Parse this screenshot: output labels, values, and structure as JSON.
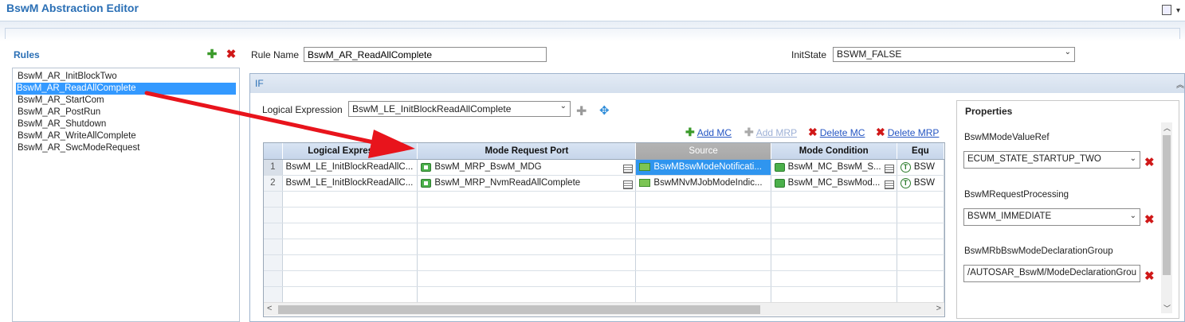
{
  "window": {
    "title": "BswM Abstraction Editor"
  },
  "rules": {
    "label": "Rules",
    "items": [
      {
        "label": "BswM_AR_InitBlockTwo",
        "selected": false
      },
      {
        "label": "BswM_AR_ReadAllComplete",
        "selected": true
      },
      {
        "label": "BswM_AR_StartCom",
        "selected": false
      },
      {
        "label": "BswM_AR_PostRun",
        "selected": false
      },
      {
        "label": "BswM_AR_Shutdown",
        "selected": false
      },
      {
        "label": "BswM_AR_WriteAllComplete",
        "selected": false
      },
      {
        "label": "BswM_AR_SwcModeRequest",
        "selected": false
      }
    ]
  },
  "rule_name": {
    "label": "Rule Name",
    "value": "BswM_AR_ReadAllComplete"
  },
  "init_state": {
    "label": "InitState",
    "value": "BSWM_FALSE"
  },
  "if_section": {
    "label": "IF",
    "logical_expression": {
      "label": "Logical Expression",
      "value": "BswM_LE_InitBlockReadAllComplete"
    },
    "actions": {
      "add_mc": "Add MC",
      "add_mrp": "Add MRP",
      "delete_mc": "Delete MC",
      "delete_mrp": "Delete MRP"
    },
    "table": {
      "headers": [
        "Logical Expression",
        "Mode Request Port",
        "Source",
        "Mode Condition",
        "Equ"
      ],
      "rows": [
        {
          "num": "1",
          "le": "BswM_LE_InitBlockReadAllC...",
          "mrp": "BswM_MRP_BswM_MDG",
          "source": "BswMBswModeNotificati...",
          "mc": "BswM_MC_BswM_S...",
          "equ": "BSW"
        },
        {
          "num": "2",
          "le": "BswM_LE_InitBlockReadAllC...",
          "mrp": "BswM_MRP_NvmReadAllComplete",
          "source": "BswMNvMJobModeIndic...",
          "mc": "BswM_MC_BswMod...",
          "equ": "BSW"
        }
      ]
    }
  },
  "properties": {
    "label": "Properties",
    "fields": [
      {
        "label": "BswMModeValueRef",
        "value": "ECUM_STATE_STARTUP_TWO"
      },
      {
        "label": "BswMRequestProcessing",
        "value": "BSWM_IMMEDIATE"
      },
      {
        "label": "BswMRbBswModeDeclarationGroup",
        "value": "/AUTOSAR_BswM/ModeDeclarationGrou"
      }
    ]
  },
  "colors": {
    "accent": "#2a6fb5",
    "selection": "#3399ff",
    "annotation_arrow": "#e8141c"
  }
}
